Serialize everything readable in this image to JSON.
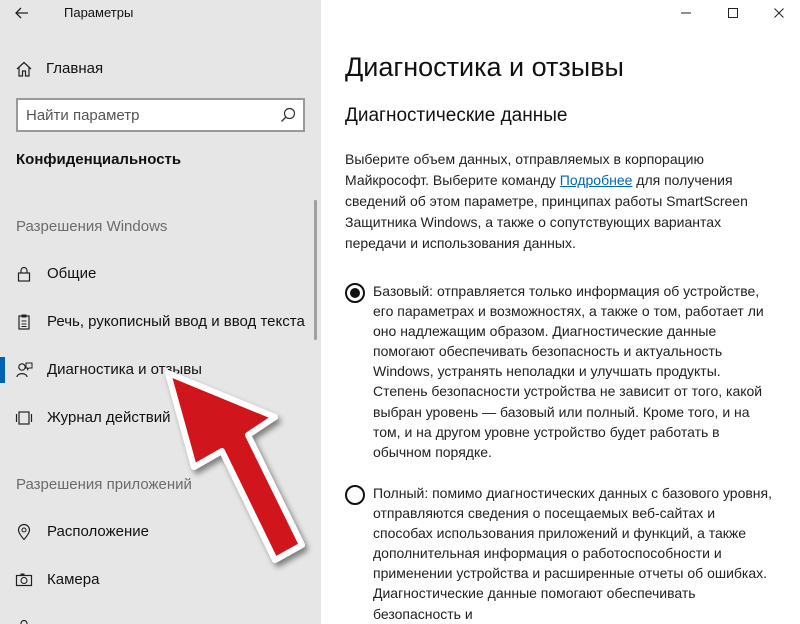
{
  "app": {
    "title": "Параметры"
  },
  "sidebar": {
    "home_label": "Главная",
    "search_placeholder": "Найти параметр",
    "section_title": "Конфиденциальность",
    "group1_label": "Разрешения Windows",
    "group2_label": "Разрешения приложений",
    "items": [
      {
        "label": "Общие",
        "icon": "lock-icon"
      },
      {
        "label": "Речь, рукописный ввод и ввод текста",
        "icon": "clipboard-icon"
      },
      {
        "label": "Диагностика и отзывы",
        "icon": "feedback-person-icon",
        "active": true
      },
      {
        "label": "Журнал действий",
        "icon": "timeline-icon"
      },
      {
        "label": "Расположение",
        "icon": "location-icon"
      },
      {
        "label": "Камера",
        "icon": "camera-icon"
      }
    ]
  },
  "main": {
    "title": "Диагностика и отзывы",
    "subheader": "Диагностические данные",
    "description_before_link": "Выберите объем данных, отправляемых в корпорацию Майкрософт. Выберите команду ",
    "description_link": "Подробнее",
    "description_after_link": " для получения сведений об этом параметре, принципах работы SmartScreen Защитника Windows, а также о сопутствующих вариантах передачи и использования данных.",
    "options": [
      {
        "text": "Базовый: отправляется только информация об устройстве, его параметрах и возможностях, а также о том, работает ли оно надлежащим образом. Диагностические данные помогают обеспечивать безопасность и актуальность Windows, устранять неполадки и улучшать продукты. Степень безопасности устройства не зависит от того, какой выбран уровень — базовый или полный. Кроме того, и на том, и на другом уровне устройство будет работать в обычном порядке.",
        "selected": true
      },
      {
        "text": "Полный: помимо диагностических данных с базового уровня, отправляются сведения о посещаемых веб-сайтах и способах использования приложений и функций, а также дополнительная информация о работоспособности и применении устройства и расширенные отчеты об ошибках. Диагностические данные помогают обеспечивать безопасность и",
        "selected": false
      }
    ]
  },
  "colors": {
    "accent": "#0063b1",
    "link": "#0066b4",
    "arrow": "#d0161b",
    "sidebar_bg": "#e6e6e6"
  }
}
